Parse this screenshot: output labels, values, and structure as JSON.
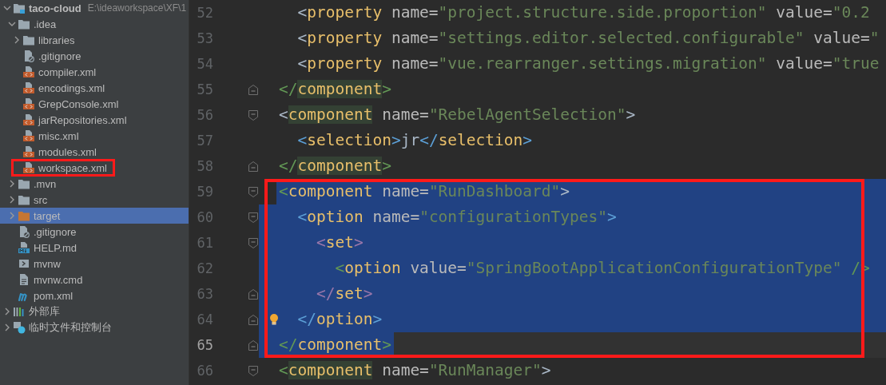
{
  "project_tree": {
    "items": [
      {
        "kind": "module",
        "label": "taco-cloud",
        "path": "E:\\ideaworkspace\\XF\\1",
        "expanded": true,
        "selected": false,
        "children": [
          {
            "kind": "folder",
            "label": ".idea",
            "expanded": true,
            "selected": false,
            "children": [
              {
                "kind": "folder",
                "label": "libraries",
                "expanded": false,
                "selected": false
              },
              {
                "kind": "ignore-file",
                "label": ".gitignore",
                "selected": false
              },
              {
                "kind": "xml-file",
                "label": "compiler.xml",
                "selected": false
              },
              {
                "kind": "xml-file",
                "label": "encodings.xml",
                "selected": false
              },
              {
                "kind": "xml-file",
                "label": "GrepConsole.xml",
                "selected": false
              },
              {
                "kind": "xml-file",
                "label": "jarRepositories.xml",
                "selected": false
              },
              {
                "kind": "xml-file",
                "label": "misc.xml",
                "selected": false
              },
              {
                "kind": "xml-file",
                "label": "modules.xml",
                "selected": false
              },
              {
                "kind": "xml-file",
                "label": "workspace.xml",
                "selected": false,
                "boxed": true
              }
            ]
          },
          {
            "kind": "folder",
            "label": ".mvn",
            "expanded": false,
            "selected": false
          },
          {
            "kind": "folder",
            "label": "src",
            "expanded": false,
            "selected": false
          },
          {
            "kind": "excluded-folder",
            "label": "target",
            "expanded": false,
            "selected": true
          },
          {
            "kind": "ignore-file",
            "label": ".gitignore",
            "selected": false
          },
          {
            "kind": "md-file",
            "label": "HELP.md",
            "selected": false
          },
          {
            "kind": "shell-file",
            "label": "mvnw",
            "selected": false
          },
          {
            "kind": "text-file",
            "label": "mvnw.cmd",
            "selected": false
          },
          {
            "kind": "maven-file",
            "label": "pom.xml",
            "selected": false
          }
        ]
      },
      {
        "kind": "library",
        "label": "外部库",
        "expanded": false,
        "selected": false
      },
      {
        "kind": "scratch",
        "label": "临时文件和控制台",
        "expanded": false,
        "selected": false
      }
    ]
  },
  "editor": {
    "blocks": [
      {
        "lines": [
          {
            "number": "52",
            "tokens": [
              {
                "kind": "bracket",
                "text": "  <",
                "color": "#a9b7c6"
              },
              {
                "kind": "tag",
                "text": "property"
              },
              {
                "kind": "attr",
                "text": " name="
              },
              {
                "kind": "value",
                "text": "\"project.structure.side.proportion\""
              },
              {
                "kind": "attr",
                "text": " value="
              },
              {
                "kind": "value",
                "text": "\"0.2"
              }
            ]
          },
          {
            "number": "53",
            "tokens": [
              {
                "kind": "bracket",
                "text": "  <",
                "color": "#a9b7c6"
              },
              {
                "kind": "tag",
                "text": "property"
              },
              {
                "kind": "attr",
                "text": " name="
              },
              {
                "kind": "value",
                "text": "\"settings.editor.selected.configurable\""
              },
              {
                "kind": "attr",
                "text": " value="
              },
              {
                "kind": "value",
                "text": "\""
              }
            ]
          },
          {
            "number": "54",
            "tokens": [
              {
                "kind": "bracket",
                "text": "  <",
                "color": "#a9b7c6"
              },
              {
                "kind": "tag",
                "text": "property"
              },
              {
                "kind": "attr",
                "text": " name="
              },
              {
                "kind": "value",
                "text": "\"vue.rearranger.settings.migration\""
              },
              {
                "kind": "attr",
                "text": " value="
              },
              {
                "kind": "value",
                "text": "\"true"
              }
            ]
          },
          {
            "number": "55",
            "fold": {
              "kind": "end"
            },
            "tokens": [
              {
                "kind": "bracket",
                "text": "</",
                "color": "#629755"
              },
              {
                "kind": "tag",
                "text": "component",
                "matched": true
              },
              {
                "kind": "bracket",
                "text": ">",
                "color": "#629755"
              }
            ]
          },
          {
            "number": "56",
            "fold": {
              "kind": "start"
            },
            "tokens": [
              {
                "kind": "bracket",
                "text": "<",
                "color": "#a9b7c6"
              },
              {
                "kind": "tag",
                "text": "component",
                "matched": true
              },
              {
                "kind": "attr",
                "text": " name="
              },
              {
                "kind": "value",
                "text": "\"RebelAgentSelection\""
              },
              {
                "kind": "bracket",
                "text": ">",
                "color": "#a9b7c6"
              }
            ]
          },
          {
            "number": "57",
            "tokens": [
              {
                "kind": "bracket",
                "text": "  <",
                "color": "#5c9fd6"
              },
              {
                "kind": "tag",
                "text": "selection"
              },
              {
                "kind": "bracket",
                "text": ">",
                "color": "#5c9fd6"
              },
              {
                "kind": "text",
                "text": "jr"
              },
              {
                "kind": "bracket",
                "text": "</",
                "color": "#5c9fd6"
              },
              {
                "kind": "tag",
                "text": "selection"
              },
              {
                "kind": "bracket",
                "text": ">",
                "color": "#5c9fd6"
              }
            ]
          },
          {
            "number": "58",
            "fold": {
              "kind": "end"
            },
            "tokens": [
              {
                "kind": "bracket",
                "text": "</",
                "color": "#629755"
              },
              {
                "kind": "tag",
                "text": "component",
                "matched": true
              },
              {
                "kind": "bracket",
                "text": ">",
                "color": "#629755"
              }
            ]
          }
        ]
      },
      {
        "boxed": true,
        "lines": [
          {
            "number": "59",
            "fold": {
              "kind": "start"
            },
            "selection": {
              "kind": "start"
            },
            "tokens": [
              {
                "kind": "bracket",
                "text": "<",
                "color": "#629755"
              },
              {
                "kind": "tag",
                "text": "component"
              },
              {
                "kind": "attr",
                "text": " name="
              },
              {
                "kind": "value",
                "text": "\"RunDashboard\""
              },
              {
                "kind": "bracket",
                "text": ">",
                "color": "#a9b7c6"
              }
            ]
          },
          {
            "number": "60",
            "fold": {
              "kind": "start"
            },
            "selection": {
              "kind": "full"
            },
            "tokens": [
              {
                "kind": "bracket",
                "text": "  <",
                "color": "#5c9fd6"
              },
              {
                "kind": "tag",
                "text": "option"
              },
              {
                "kind": "attr",
                "text": " name="
              },
              {
                "kind": "value",
                "text": "\"configurationTypes\""
              },
              {
                "kind": "bracket",
                "text": ">",
                "color": "#5c9fd6"
              }
            ]
          },
          {
            "number": "61",
            "fold": {
              "kind": "start"
            },
            "selection": {
              "kind": "full"
            },
            "tokens": [
              {
                "kind": "bracket",
                "text": "    <",
                "color": "#9876aa"
              },
              {
                "kind": "tag",
                "text": "set"
              },
              {
                "kind": "bracket",
                "text": ">",
                "color": "#9876aa"
              }
            ]
          },
          {
            "number": "62",
            "selection": {
              "kind": "full"
            },
            "tokens": [
              {
                "kind": "bracket",
                "text": "      <",
                "color": "#629755"
              },
              {
                "kind": "tag",
                "text": "option"
              },
              {
                "kind": "attr",
                "text": " value="
              },
              {
                "kind": "value",
                "text": "\"SpringBootApplicationConfigurationType\""
              },
              {
                "kind": "bracket",
                "text": " />",
                "color": "#629755"
              }
            ]
          },
          {
            "number": "63",
            "fold": {
              "kind": "end"
            },
            "selection": {
              "kind": "full"
            },
            "tokens": [
              {
                "kind": "bracket",
                "text": "    </",
                "color": "#9876aa"
              },
              {
                "kind": "tag",
                "text": "set"
              },
              {
                "kind": "bracket",
                "text": ">",
                "color": "#9876aa"
              }
            ]
          },
          {
            "number": "64",
            "fold": {
              "kind": "end"
            },
            "selection": {
              "kind": "full"
            },
            "bulb": true,
            "tokens": [
              {
                "kind": "bracket",
                "text": "  </",
                "color": "#5c9fd6"
              },
              {
                "kind": "tag",
                "text": "option"
              },
              {
                "kind": "bracket",
                "text": ">",
                "color": "#5c9fd6"
              }
            ]
          },
          {
            "number": "65",
            "fold": {
              "kind": "end"
            },
            "selection": {
              "kind": "end"
            },
            "current": true,
            "tokens": [
              {
                "kind": "bracket",
                "text": "</",
                "color": "#629755"
              },
              {
                "kind": "tag",
                "text": "component"
              },
              {
                "kind": "bracket",
                "text": ">",
                "color": "#629755"
              }
            ]
          }
        ]
      },
      {
        "lines": [
          {
            "number": "66",
            "fold": {
              "kind": "start"
            },
            "tokens": [
              {
                "kind": "bracket",
                "text": "<",
                "color": "#629755"
              },
              {
                "kind": "tag",
                "text": "component",
                "matched": true
              },
              {
                "kind": "attr",
                "text": " name="
              },
              {
                "kind": "value",
                "text": "\"RunManager\""
              },
              {
                "kind": "bracket",
                "text": ">",
                "color": "#a9b7c6"
              }
            ]
          }
        ]
      }
    ]
  }
}
